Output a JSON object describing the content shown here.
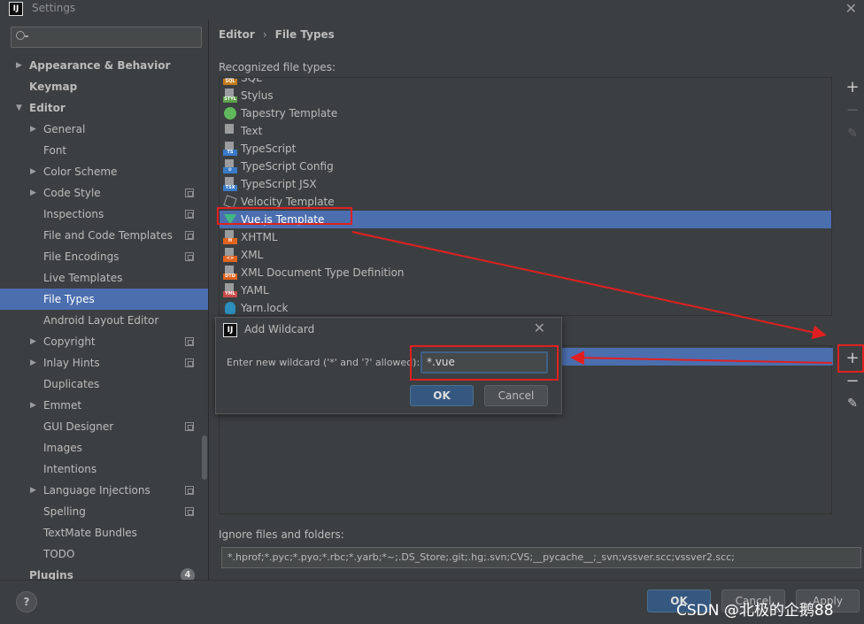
{
  "window": {
    "title": "Settings",
    "app_icon_text": "IJ",
    "close_glyph": "✕"
  },
  "sidebar": {
    "search_placeholder": "",
    "items": [
      {
        "label": "Appearance & Behavior",
        "level": 0,
        "bold": true,
        "arrow": "right"
      },
      {
        "label": "Keymap",
        "level": 0,
        "bold": true
      },
      {
        "label": "Editor",
        "level": 0,
        "bold": true,
        "arrow": "down"
      },
      {
        "label": "General",
        "level": 1,
        "arrow": "right"
      },
      {
        "label": "Font",
        "level": 1
      },
      {
        "label": "Color Scheme",
        "level": 1,
        "arrow": "right"
      },
      {
        "label": "Code Style",
        "level": 1,
        "arrow": "right",
        "scope": true
      },
      {
        "label": "Inspections",
        "level": 1,
        "scope": true
      },
      {
        "label": "File and Code Templates",
        "level": 1,
        "scope": true
      },
      {
        "label": "File Encodings",
        "level": 1,
        "scope": true
      },
      {
        "label": "Live Templates",
        "level": 1
      },
      {
        "label": "File Types",
        "level": 1,
        "selected": true
      },
      {
        "label": "Android Layout Editor",
        "level": 1
      },
      {
        "label": "Copyright",
        "level": 1,
        "arrow": "right",
        "scope": true
      },
      {
        "label": "Inlay Hints",
        "level": 1,
        "arrow": "right",
        "scope": true
      },
      {
        "label": "Duplicates",
        "level": 1
      },
      {
        "label": "Emmet",
        "level": 1,
        "arrow": "right"
      },
      {
        "label": "GUI Designer",
        "level": 1,
        "scope": true
      },
      {
        "label": "Images",
        "level": 1
      },
      {
        "label": "Intentions",
        "level": 1
      },
      {
        "label": "Language Injections",
        "level": 1,
        "arrow": "right",
        "scope": true
      },
      {
        "label": "Spelling",
        "level": 1,
        "scope": true
      },
      {
        "label": "TextMate Bundles",
        "level": 1
      },
      {
        "label": "TODO",
        "level": 1
      },
      {
        "label": "Plugins",
        "level": 0,
        "bold": true,
        "badge": "4"
      }
    ]
  },
  "main": {
    "breadcrumb": {
      "parent": "Editor",
      "separator": "›",
      "current": "File Types"
    },
    "recognized_label": "Recognized file types:",
    "file_types": [
      {
        "label": "SQL",
        "icon": "sql-file-icon",
        "tag": "SQL",
        "color": "#c57b1a"
      },
      {
        "label": "Stylus",
        "icon": "stylus-file-icon",
        "tag": "STYL",
        "color": "#5fa04e"
      },
      {
        "label": "Tapestry Template",
        "icon": "tapestry-icon",
        "color": "#5fb85a"
      },
      {
        "label": "Text",
        "icon": "text-file-icon",
        "tag": "",
        "color": "#9a9c9e"
      },
      {
        "label": "TypeScript",
        "icon": "typescript-file-icon",
        "tag": "TS",
        "color": "#3a7bc8"
      },
      {
        "label": "TypeScript Config",
        "icon": "typescript-config-icon",
        "tag": "⚙",
        "color": "#3a7bc8"
      },
      {
        "label": "TypeScript JSX",
        "icon": "typescript-jsx-icon",
        "tag": "TSX",
        "color": "#3a7bc8"
      },
      {
        "label": "Velocity Template",
        "icon": "velocity-icon",
        "color": "#9a9c9e"
      },
      {
        "label": "Vue.js Template",
        "icon": "vue-icon",
        "color": "#41b883",
        "selected": true
      },
      {
        "label": "XHTML",
        "icon": "xhtml-file-icon",
        "tag": "H",
        "color": "#e0641e"
      },
      {
        "label": "XML",
        "icon": "xml-file-icon",
        "tag": "<>",
        "color": "#e0641e"
      },
      {
        "label": "XML Document Type Definition",
        "icon": "dtd-file-icon",
        "tag": "DTD",
        "color": "#e0641e"
      },
      {
        "label": "YAML",
        "icon": "yaml-file-icon",
        "tag": "YML",
        "color": "#c94a4a"
      },
      {
        "label": "Yarn.lock",
        "icon": "yarn-icon",
        "color": "#2c8ebb"
      }
    ],
    "tools": {
      "add": "+",
      "remove": "−",
      "edit": "✎"
    },
    "ignore_label": "Ignore files and folders:",
    "ignore_value": "*.hprof;*.pyc;*.pyo;*.rbc;*.yarb;*~;.DS_Store;.git;.hg;.svn;CVS;__pycache__;_svn;vssver.scc;vssver2.scc;"
  },
  "dialog": {
    "title": "Add Wildcard",
    "close_glyph": "✕",
    "prompt": "Enter new wildcard ('*' and '?' allowed):",
    "value": "*.vue",
    "ok": "OK",
    "cancel": "Cancel"
  },
  "footer": {
    "help": "?",
    "ok": "OK",
    "cancel": "Cancel",
    "apply": "Apply",
    "watermark": "CSDN @北极的企鹅88"
  },
  "colors": {
    "selection": "#4b6eaf",
    "annotation": "#e02020",
    "background": "#3c3f41"
  }
}
